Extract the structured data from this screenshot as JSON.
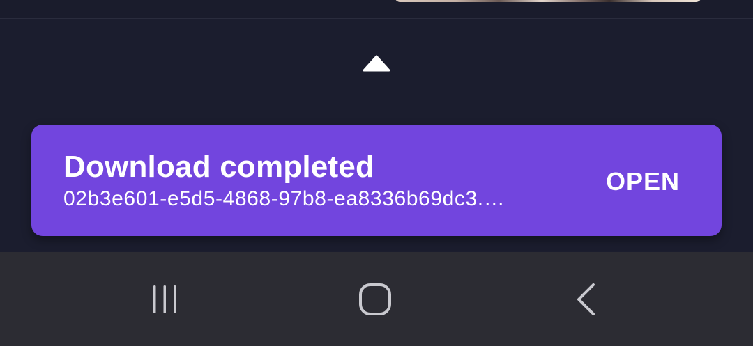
{
  "background": {
    "color": "#1b1d2e"
  },
  "top_content": {
    "thumbnail": "image-thumbnail"
  },
  "expand_handle": {
    "icon": "chevron-up-icon",
    "color": "#ffffff"
  },
  "snackbar": {
    "title": "Download completed",
    "subtitle": "02b3e601-e5d5-4868-97b8-ea8336b69dc3.…",
    "action_label": "OPEN",
    "background_color": "#7245de",
    "text_color": "#ffffff"
  },
  "nav_bar": {
    "background_color": "#2c2c33",
    "icon_color": "#c9c9cf",
    "buttons": [
      {
        "icon": "recent-apps-icon"
      },
      {
        "icon": "home-icon"
      },
      {
        "icon": "back-icon"
      }
    ]
  }
}
